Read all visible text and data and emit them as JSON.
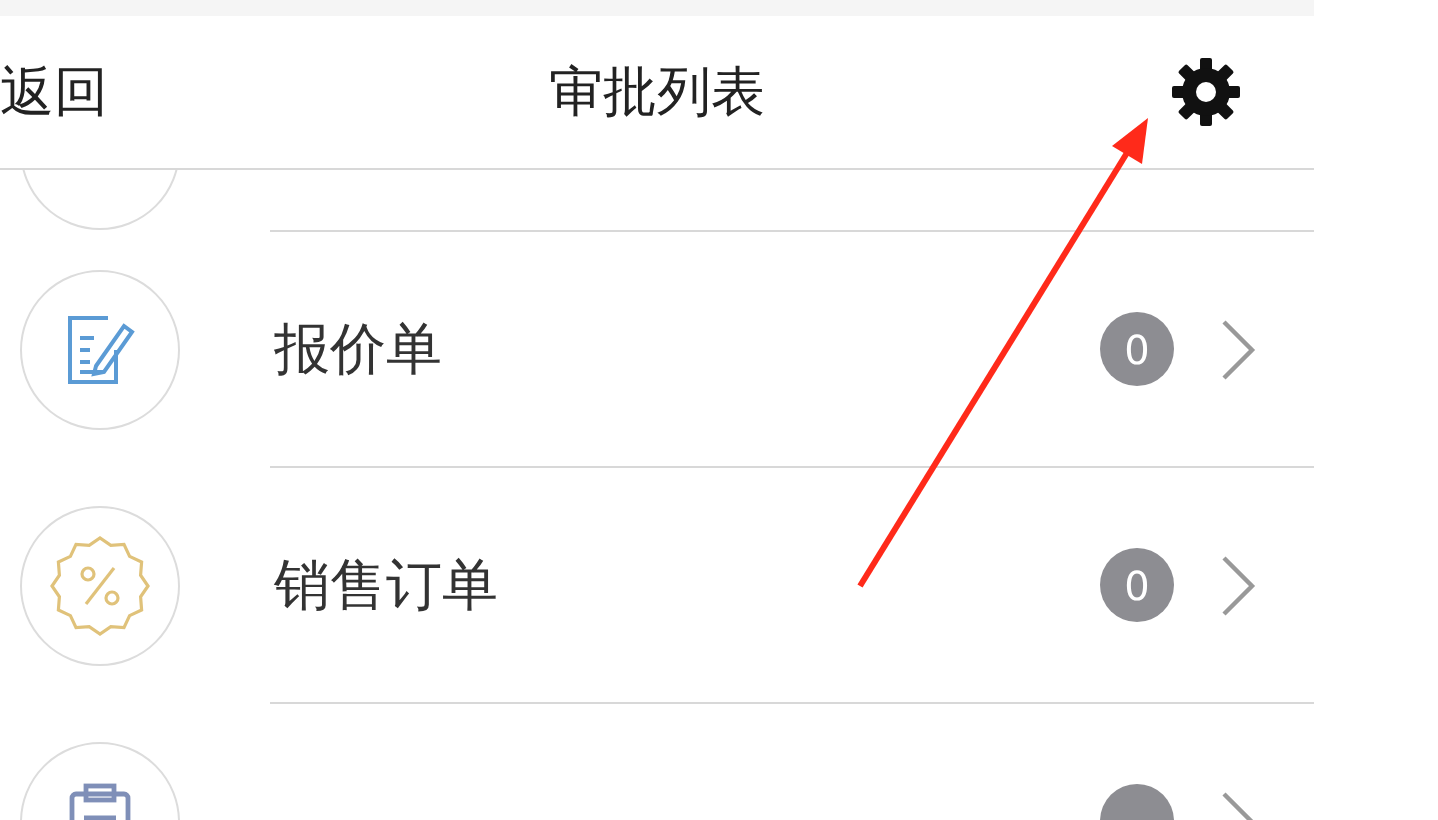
{
  "header": {
    "back": "返回",
    "title": "审批列表"
  },
  "items": [
    {
      "kind": "quote",
      "label": "报价单",
      "count": "0"
    },
    {
      "kind": "order",
      "label": "销售订单",
      "count": "0"
    },
    {
      "kind": "delivery"
    }
  ]
}
